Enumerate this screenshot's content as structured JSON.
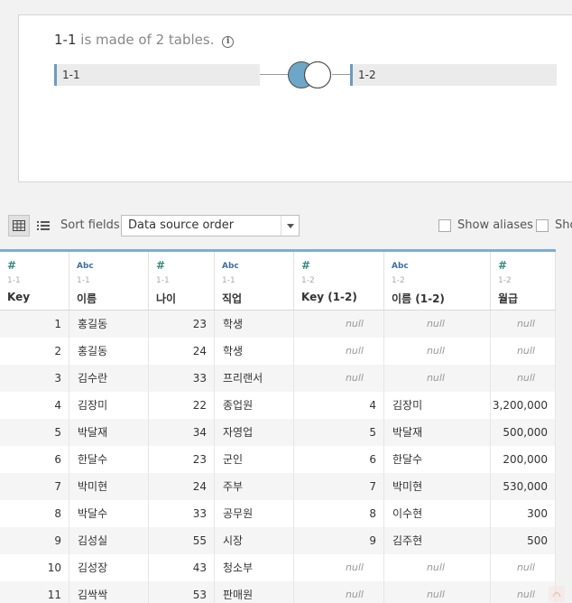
{
  "join": {
    "logical_table": "1-1",
    "made_of_text": "is made of 2 tables.",
    "left_table": "1-1",
    "right_table": "1-2",
    "join_type_icon": "full-outer-join-icon",
    "accent_color": "#6a9cc0"
  },
  "toolbar": {
    "grid_view_icon": "grid-view-icon",
    "list_view_icon": "list-view-icon",
    "sort_label": "Sort fields",
    "sort_value": "Data source order",
    "show_aliases": "Show aliases",
    "show_hidden": "Sho"
  },
  "columns": [
    {
      "type": "#",
      "source": "1-1",
      "name": "Key"
    },
    {
      "type": "Abc",
      "source": "1-1",
      "name": "이름"
    },
    {
      "type": "#",
      "source": "1-1",
      "name": "나이"
    },
    {
      "type": "Abc",
      "source": "1-1",
      "name": "직업"
    },
    {
      "type": "#",
      "source": "1-2",
      "name": "Key (1-2)"
    },
    {
      "type": "Abc",
      "source": "1-2",
      "name": "이름 (1-2)"
    },
    {
      "type": "#",
      "source": "1-2",
      "name": "월급"
    }
  ],
  "rows": [
    [
      "1",
      "홍길동",
      "23",
      "학생",
      "null",
      "null",
      "null"
    ],
    [
      "2",
      "홍길동",
      "24",
      "학생",
      "null",
      "null",
      "null"
    ],
    [
      "3",
      "김수란",
      "33",
      "프리랜서",
      "null",
      "null",
      "null"
    ],
    [
      "4",
      "김장미",
      "22",
      "종업원",
      "4",
      "김장미",
      "3,200,000"
    ],
    [
      "5",
      "박달재",
      "34",
      "자영업",
      "5",
      "박달재",
      "500,000"
    ],
    [
      "6",
      "한달수",
      "23",
      "군인",
      "6",
      "한달수",
      "200,000"
    ],
    [
      "7",
      "박미현",
      "24",
      "주부",
      "7",
      "박미현",
      "530,000"
    ],
    [
      "8",
      "박달수",
      "33",
      "공무원",
      "8",
      "이수현",
      "300"
    ],
    [
      "9",
      "김성실",
      "55",
      "시장",
      "9",
      "김주현",
      "500"
    ],
    [
      "10",
      "김성장",
      "43",
      "청소부",
      "null",
      "null",
      "null"
    ],
    [
      "11",
      "김싹싹",
      "53",
      "판매원",
      "null",
      "null",
      "null"
    ]
  ]
}
